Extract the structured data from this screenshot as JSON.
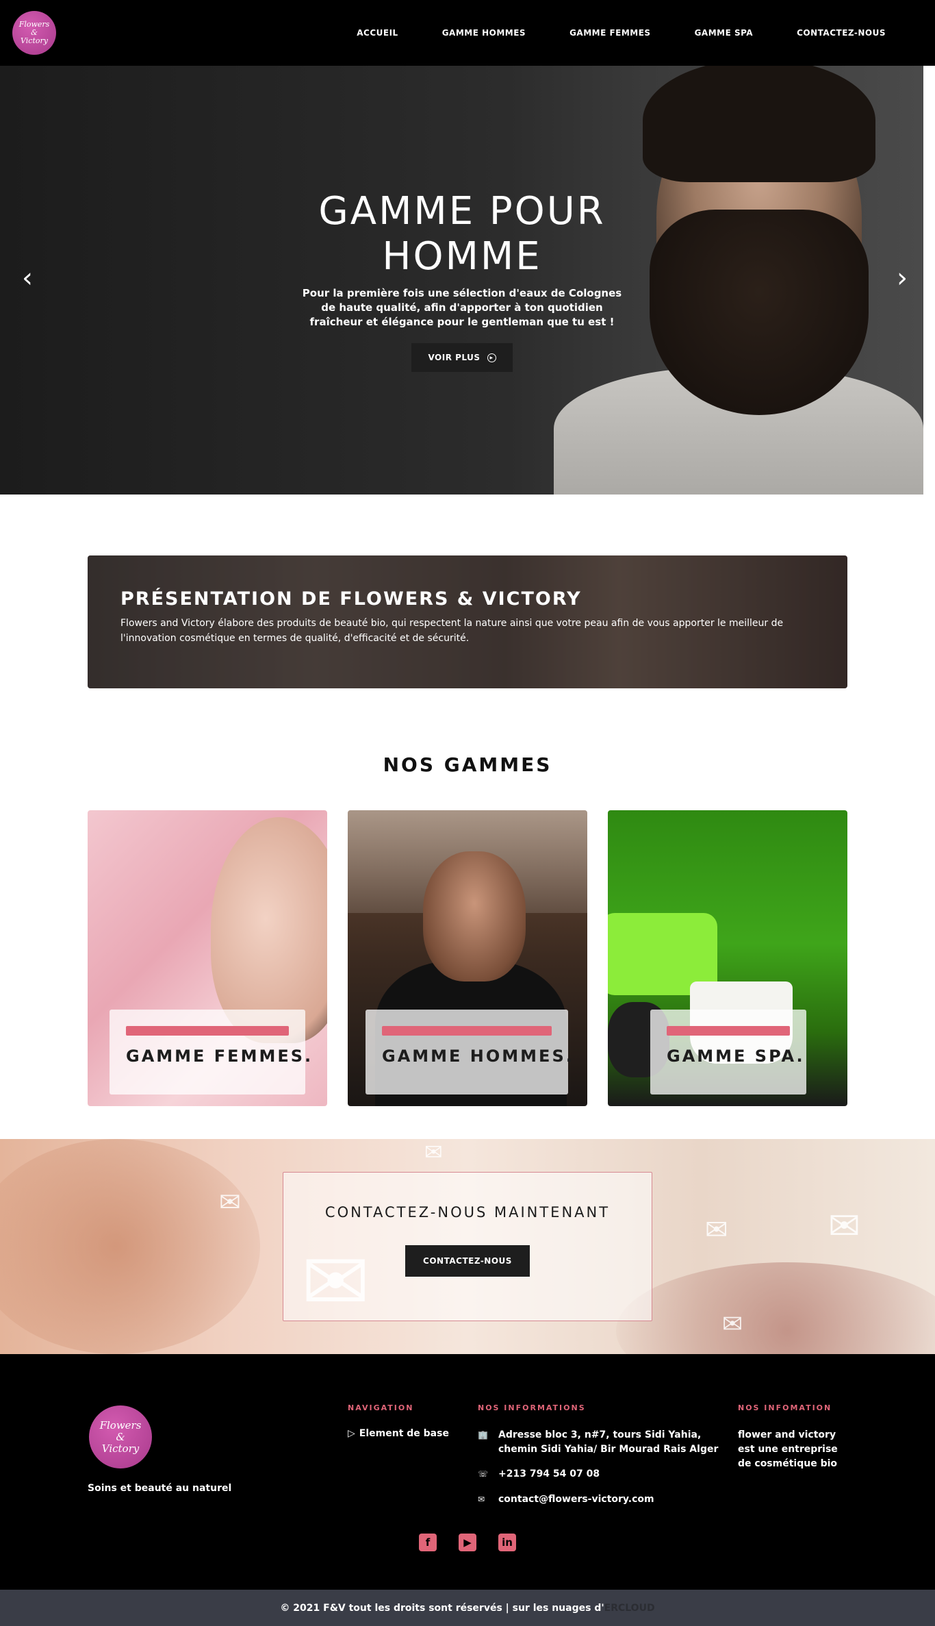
{
  "header": {
    "logo_line1": "Flowers",
    "logo_line2": "&",
    "logo_line3": "Victory",
    "nav": [
      "ACCUEIL",
      "GAMME HOMMES",
      "GAMME FEMMES",
      "GAMME SPA",
      "CONTACTEZ-NOUS"
    ]
  },
  "hero": {
    "title_line1": "GAMME POUR",
    "title_line2": "HOMME",
    "text": "Pour la première fois une sélection d'eaux de Colognes de haute qualité, afin d'apporter à ton quotidien fraîcheur et élégance pour le gentleman que tu est !",
    "button": "VOIR PLUS",
    "prev_icon": "chevron-left-icon",
    "next_icon": "chevron-right-icon"
  },
  "presentation": {
    "title": "PRÉSENTATION DE FLOWERS & VICTORY",
    "text": "Flowers and Victory élabore des produits de beauté bio, qui respectent la nature ainsi que votre peau afin de vous apporter le meilleur de l'innovation cosmétique en termes de qualité, d'efficacité et de sécurité."
  },
  "gammes": {
    "title": "NOS GAMMES",
    "cards": [
      "GAMME FEMMES.",
      "GAMME HOMMES.",
      "GAMME SPA."
    ]
  },
  "contact": {
    "title": "CONTACTEZ-NOUS MAINTENANT",
    "button": "CONTACTEZ-NOUS"
  },
  "footer": {
    "logo_line1": "Flowers",
    "logo_line2": "&",
    "logo_line3": "Victory",
    "tagline": "Soins et beauté au naturel",
    "nav_heading": "NAVIGATION",
    "nav_item": "Element de base",
    "info_heading": "NOS INFORMATIONS",
    "address_line1": "Adresse bloc 3, n#7, tours Sidi Yahia,",
    "address_line2": "chemin Sidi Yahia/ Bir Mourad Rais Alger",
    "phone": "+213 794 54 07 08",
    "email": "contact@flowers-victory.com",
    "about_heading": "NOS INFOMATION",
    "about_text": "flower and victory est une entreprise de cosmétique bio",
    "socials": [
      "facebook-icon",
      "youtube-icon",
      "linkedin-icon"
    ]
  },
  "copyright": {
    "text": "© 2021 F&V tout les droits sont réservés | sur les nuages d'",
    "brand": "ERCLOUD"
  },
  "colors": {
    "accent": "#e06578",
    "logo": "#c24a9e",
    "dark": "#000000",
    "button": "#1e1e1e",
    "copyright_bg": "#3a3d47"
  }
}
